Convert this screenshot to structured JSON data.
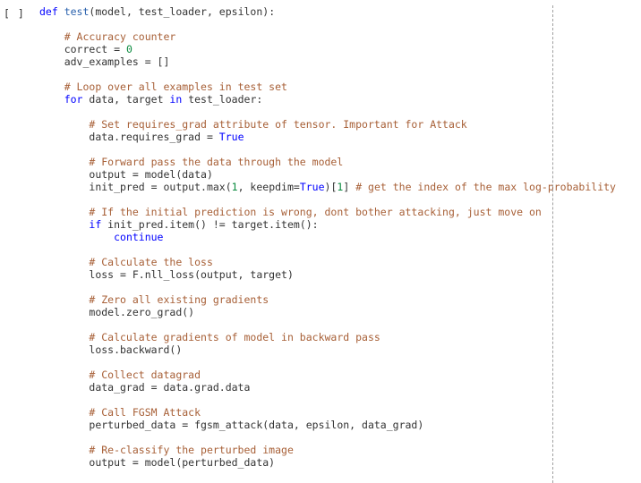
{
  "cell": {
    "prompt": "[ ]",
    "lines": [
      {
        "indent": "",
        "tokens": [
          {
            "t": "def ",
            "c": "kw"
          },
          {
            "t": "test",
            "c": "fn"
          },
          {
            "t": "(model, test_loader, epsilon):",
            "c": ""
          }
        ]
      },
      {
        "indent": "",
        "tokens": []
      },
      {
        "indent": "    ",
        "tokens": [
          {
            "t": "# Accuracy counter",
            "c": "cmt"
          }
        ]
      },
      {
        "indent": "    ",
        "tokens": [
          {
            "t": "correct = ",
            "c": ""
          },
          {
            "t": "0",
            "c": "num"
          }
        ]
      },
      {
        "indent": "    ",
        "tokens": [
          {
            "t": "adv_examples = []",
            "c": ""
          }
        ]
      },
      {
        "indent": "",
        "tokens": []
      },
      {
        "indent": "    ",
        "tokens": [
          {
            "t": "# Loop over all examples in test set",
            "c": "cmt"
          }
        ]
      },
      {
        "indent": "    ",
        "tokens": [
          {
            "t": "for",
            "c": "kw"
          },
          {
            "t": " data, target ",
            "c": ""
          },
          {
            "t": "in",
            "c": "kw"
          },
          {
            "t": " test_loader:",
            "c": ""
          }
        ]
      },
      {
        "indent": "",
        "tokens": []
      },
      {
        "indent": "        ",
        "tokens": [
          {
            "t": "# Set requires_grad attribute of tensor. Important for Attack",
            "c": "cmt"
          }
        ]
      },
      {
        "indent": "        ",
        "tokens": [
          {
            "t": "data.requires_grad = ",
            "c": ""
          },
          {
            "t": "True",
            "c": "kw"
          }
        ]
      },
      {
        "indent": "",
        "tokens": []
      },
      {
        "indent": "        ",
        "tokens": [
          {
            "t": "# Forward pass the data through the model",
            "c": "cmt"
          }
        ]
      },
      {
        "indent": "        ",
        "tokens": [
          {
            "t": "output = model(data)",
            "c": ""
          }
        ]
      },
      {
        "indent": "        ",
        "tokens": [
          {
            "t": "init_pred = output.max(",
            "c": ""
          },
          {
            "t": "1",
            "c": "num"
          },
          {
            "t": ", keepdim=",
            "c": ""
          },
          {
            "t": "True",
            "c": "kw"
          },
          {
            "t": ")[",
            "c": ""
          },
          {
            "t": "1",
            "c": "num"
          },
          {
            "t": "] ",
            "c": ""
          },
          {
            "t": "# get the index of the max log-probability",
            "c": "cmt"
          }
        ]
      },
      {
        "indent": "",
        "tokens": []
      },
      {
        "indent": "        ",
        "tokens": [
          {
            "t": "# If the initial prediction is wrong, dont bother attacking, just move on",
            "c": "cmt"
          }
        ]
      },
      {
        "indent": "        ",
        "tokens": [
          {
            "t": "if",
            "c": "kw"
          },
          {
            "t": " init_pred.item() != target.item():",
            "c": ""
          }
        ]
      },
      {
        "indent": "            ",
        "tokens": [
          {
            "t": "continue",
            "c": "kw"
          }
        ]
      },
      {
        "indent": "",
        "tokens": []
      },
      {
        "indent": "        ",
        "tokens": [
          {
            "t": "# Calculate the loss",
            "c": "cmt"
          }
        ]
      },
      {
        "indent": "        ",
        "tokens": [
          {
            "t": "loss = F.nll_loss(output, target)",
            "c": ""
          }
        ]
      },
      {
        "indent": "",
        "tokens": []
      },
      {
        "indent": "        ",
        "tokens": [
          {
            "t": "# Zero all existing gradients",
            "c": "cmt"
          }
        ]
      },
      {
        "indent": "        ",
        "tokens": [
          {
            "t": "model.zero_grad()",
            "c": ""
          }
        ]
      },
      {
        "indent": "",
        "tokens": []
      },
      {
        "indent": "        ",
        "tokens": [
          {
            "t": "# Calculate gradients of model in backward pass",
            "c": "cmt"
          }
        ]
      },
      {
        "indent": "        ",
        "tokens": [
          {
            "t": "loss.backward()",
            "c": ""
          }
        ]
      },
      {
        "indent": "",
        "tokens": []
      },
      {
        "indent": "        ",
        "tokens": [
          {
            "t": "# Collect datagrad",
            "c": "cmt"
          }
        ]
      },
      {
        "indent": "        ",
        "tokens": [
          {
            "t": "data_grad = data.grad.data",
            "c": ""
          }
        ]
      },
      {
        "indent": "",
        "tokens": []
      },
      {
        "indent": "        ",
        "tokens": [
          {
            "t": "# Call FGSM Attack",
            "c": "cmt"
          }
        ]
      },
      {
        "indent": "        ",
        "tokens": [
          {
            "t": "perturbed_data = fgsm_attack(data, epsilon, data_grad)",
            "c": ""
          }
        ]
      },
      {
        "indent": "",
        "tokens": []
      },
      {
        "indent": "        ",
        "tokens": [
          {
            "t": "# Re-classify the perturbed image",
            "c": "cmt"
          }
        ]
      },
      {
        "indent": "        ",
        "tokens": [
          {
            "t": "output = model(perturbed_data)",
            "c": ""
          }
        ]
      }
    ]
  }
}
